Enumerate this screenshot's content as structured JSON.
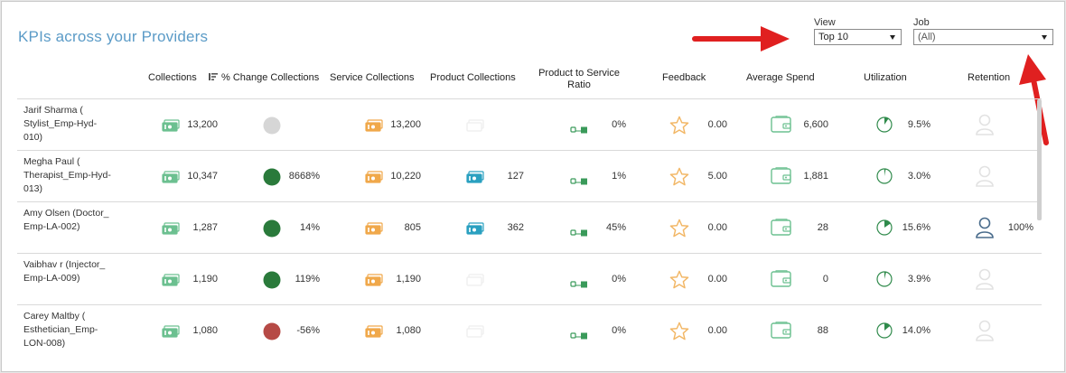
{
  "title": "KPIs across your Providers",
  "filters": {
    "view": {
      "label": "View",
      "value": "Top 10"
    },
    "job": {
      "label": "Job",
      "value": "(All)"
    }
  },
  "columns": {
    "collections": "Collections",
    "pct_change": "% Change Collections",
    "service_collections": "Service Collections",
    "product_collections": "Product Collections",
    "ratio_line1": "Product to Service",
    "ratio_line2": "Ratio",
    "feedback": "Feedback",
    "average_spend": "Average Spend",
    "utilization": "Utilization",
    "retention": "Retention"
  },
  "colors": {
    "accent_title": "#5b9bc7",
    "positive": "#2a7a3b",
    "negative": "#b64a46",
    "neutral": "#d6d6d6",
    "money_green": "#6cc090",
    "money_orange": "#f0a84a",
    "money_teal": "#2aa0c0",
    "star": "#f2b766",
    "arrow_red": "#e02020"
  },
  "rows": [
    {
      "provider": "Jarif Sharma ( Stylist_Emp-Hyd-010)",
      "collections": "13,200",
      "pct_change": "",
      "pct_status": "neutral",
      "service_collections": "13,200",
      "product_collections": "",
      "product_icon": "empty",
      "ratio": "0%",
      "feedback": "0.00",
      "average_spend": "6,600",
      "utilization": "9.5%",
      "utilization_fraction": 0.095,
      "retention": "",
      "retention_status": "empty"
    },
    {
      "provider": "Megha Paul ( Therapist_Emp-Hyd-013)",
      "collections": "10,347",
      "pct_change": "8668%",
      "pct_status": "positive",
      "service_collections": "10,220",
      "product_collections": "127",
      "product_icon": "teal",
      "ratio": "1%",
      "feedback": "5.00",
      "average_spend": "1,881",
      "utilization": "3.0%",
      "utilization_fraction": 0.03,
      "retention": "",
      "retention_status": "empty"
    },
    {
      "provider": "Amy Olsen (Doctor_ Emp-LA-002)",
      "collections": "1,287",
      "pct_change": "14%",
      "pct_status": "positive",
      "service_collections": "805",
      "product_collections": "362",
      "product_icon": "teal",
      "ratio": "45%",
      "feedback": "0.00",
      "average_spend": "28",
      "utilization": "15.6%",
      "utilization_fraction": 0.156,
      "retention": "100%",
      "retention_status": "active"
    },
    {
      "provider": "Vaibhav r (Injector_ Emp-LA-009)",
      "collections": "1,190",
      "pct_change": "119%",
      "pct_status": "positive",
      "service_collections": "1,190",
      "product_collections": "",
      "product_icon": "empty",
      "ratio": "0%",
      "feedback": "0.00",
      "average_spend": "0",
      "utilization": "3.9%",
      "utilization_fraction": 0.039,
      "retention": "",
      "retention_status": "empty"
    },
    {
      "provider": "Carey Maltby ( Esthetician_Emp-LON-008)",
      "collections": "1,080",
      "pct_change": "-56%",
      "pct_status": "negative",
      "service_collections": "1,080",
      "product_collections": "",
      "product_icon": "empty",
      "ratio": "0%",
      "feedback": "0.00",
      "average_spend": "88",
      "utilization": "14.0%",
      "utilization_fraction": 0.14,
      "retention": "",
      "retention_status": "empty"
    }
  ]
}
